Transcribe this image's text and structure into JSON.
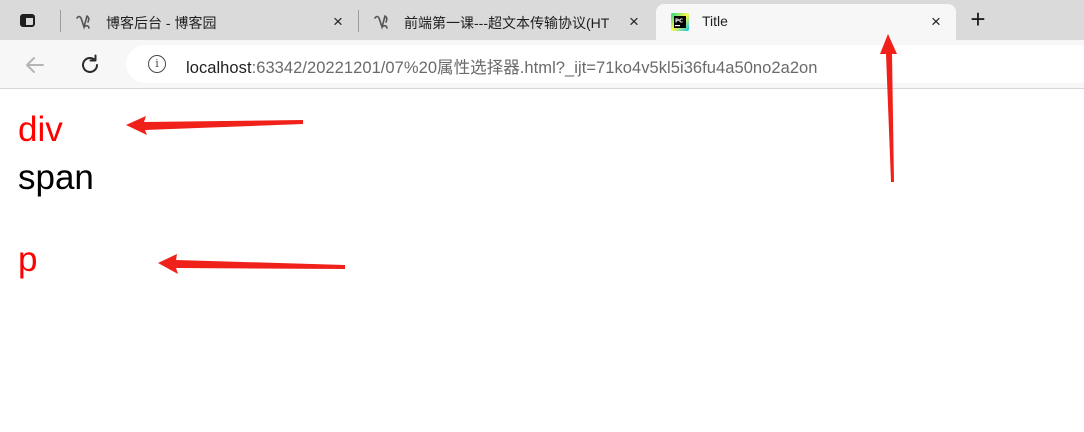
{
  "tabs": [
    {
      "title": "博客后台 - 博客园",
      "close": "×",
      "favicon": "cnblogs-icon",
      "active": false
    },
    {
      "title": "前端第一课---超文本传输协议(HT",
      "close": "×",
      "favicon": "cnblogs-icon",
      "active": false
    },
    {
      "title": "Title",
      "close": "×",
      "favicon": "pycharm-icon",
      "active": true
    }
  ],
  "new_tab_label": "+",
  "toolbar": {
    "back_icon": "back-arrow-icon",
    "reload_icon": "reload-icon",
    "info_glyph": "i",
    "url_host": "localhost",
    "url_rest": ":63342/20221201/07%20属性选择器.html?_ijt=71ko4v5kl5i36fu4a50no2a2on"
  },
  "page": {
    "div_text": "div",
    "span_text": "span",
    "p_text": "p"
  },
  "colors": {
    "highlight": "#ff0000",
    "annotation_arrow": "#f0211a",
    "tab_strip": "#dadada",
    "toolbar": "#f7f7f7"
  }
}
